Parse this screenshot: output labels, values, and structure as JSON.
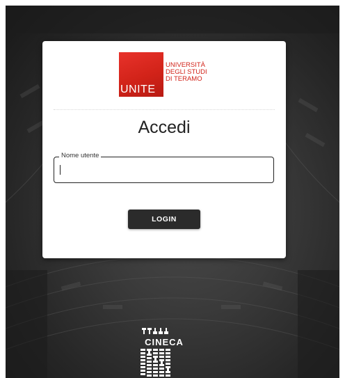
{
  "login": {
    "logo": {
      "mark_text": "UNITE",
      "lines": [
        "UNIVERSITÀ",
        "DEGLI STUDI",
        "DI TERAMO"
      ]
    },
    "title": "Accedi",
    "username_label": "Nome utente",
    "username_value": "",
    "login_label": "LOGIN"
  },
  "footer": {
    "logo_text": "CINECA"
  },
  "colors": {
    "brand_red": "#d22319",
    "button_dark": "#2b2b2b",
    "background": "#2e2e2e"
  }
}
